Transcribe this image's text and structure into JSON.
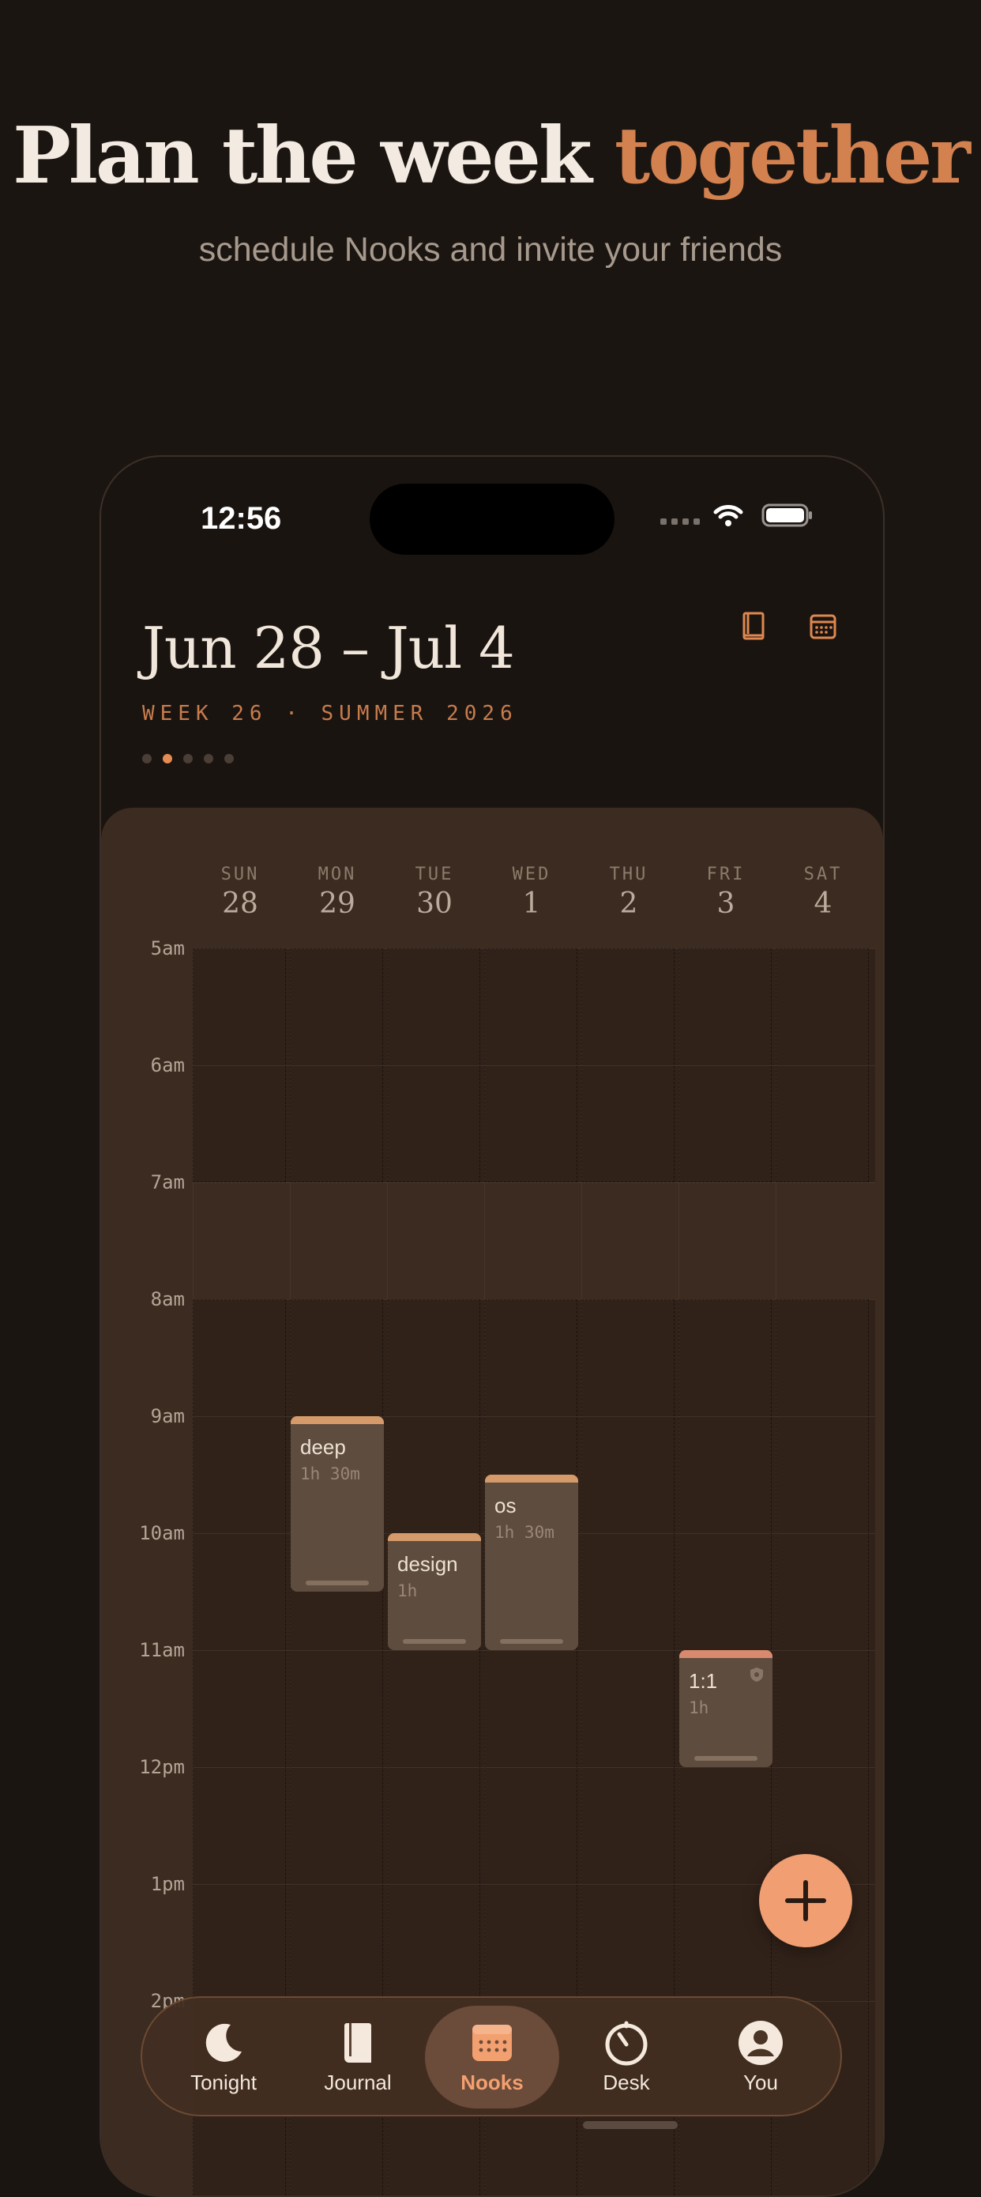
{
  "hero": {
    "headline_main": "Plan the week ",
    "headline_accent": "together",
    "subheadline": "schedule Nooks and invite your friends"
  },
  "status_bar": {
    "time": "12:56"
  },
  "header": {
    "week_title": "Jun 28 – Jul 4",
    "week_subtitle": "WEEK 26 · SUMMER 2026",
    "icons": [
      "book-icon",
      "calendar-icon"
    ],
    "page_dots": {
      "count": 5,
      "active": 1
    }
  },
  "days": [
    {
      "name": "SUN",
      "num": "28"
    },
    {
      "name": "MON",
      "num": "29"
    },
    {
      "name": "TUE",
      "num": "30"
    },
    {
      "name": "WED",
      "num": "1"
    },
    {
      "name": "THU",
      "num": "2"
    },
    {
      "name": "FRI",
      "num": "3"
    },
    {
      "name": "SAT",
      "num": "4"
    }
  ],
  "hours": [
    "5am",
    "6am",
    "7am",
    "8am",
    "9am",
    "10am",
    "11am",
    "12pm",
    "1pm",
    "2pm"
  ],
  "events": [
    {
      "title": "deep",
      "duration": "1h 30m",
      "day": 1,
      "start": 9,
      "end": 10.5,
      "color": "#d49a6a"
    },
    {
      "title": "design",
      "duration": "1h",
      "day": 2,
      "start": 10,
      "end": 11,
      "color": "#d49a6a"
    },
    {
      "title": "os",
      "duration": "1h 30m",
      "day": 3,
      "start": 9.5,
      "end": 11,
      "color": "#d49a6a"
    },
    {
      "title": "1:1",
      "duration": "1h",
      "day": 5,
      "start": 11,
      "end": 12,
      "color": "#d88a6e",
      "locked": true
    }
  ],
  "colors": {
    "accent": "#d2814f",
    "fab": "#f19e72",
    "active_tab": "#f3a070",
    "calendar_bg": "#3c2b20"
  },
  "tabs": [
    {
      "label": "Tonight",
      "icon": "moon-icon"
    },
    {
      "label": "Journal",
      "icon": "book-icon"
    },
    {
      "label": "Nooks",
      "icon": "calendar-icon",
      "active": true
    },
    {
      "label": "Desk",
      "icon": "timer-icon"
    },
    {
      "label": "You",
      "icon": "profile-icon"
    }
  ]
}
